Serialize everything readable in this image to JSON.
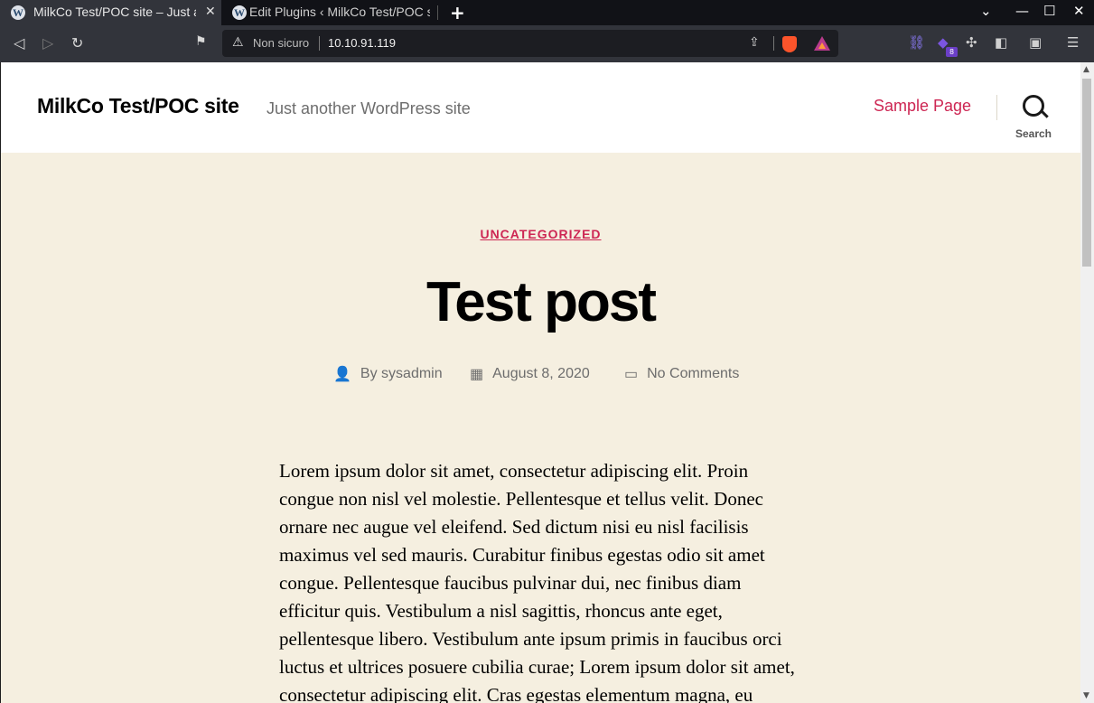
{
  "browser": {
    "tabs": [
      {
        "title": "MilkCo Test/POC site – Just another WordPress site",
        "favicon": "W",
        "close": "✕"
      },
      {
        "title": "Edit Plugins ‹ MilkCo Test/POC site — WordPress",
        "favicon": "W"
      }
    ],
    "new_tab": "+",
    "window_controls": {
      "minimize": "—",
      "maximize": "☐",
      "close": "✕"
    },
    "nav": {
      "back": "◁",
      "forward": "▷",
      "reload": "↻",
      "bookmark": "🔖"
    },
    "address": {
      "security_label": "Non sicuro",
      "url": "10.10.91.119",
      "share": "⇪"
    },
    "extensions": {
      "badge_count": "8"
    }
  },
  "site": {
    "title": "MilkCo Test/POC site",
    "description": "Just another WordPress site",
    "nav": {
      "sample_page": "Sample Page"
    },
    "search_label": "Search"
  },
  "post": {
    "category": "UNCATEGORIZED",
    "title": "Test post",
    "author": "By sysadmin",
    "date": "August 8, 2020",
    "comments": "No Comments",
    "body": "Lorem ipsum dolor sit amet, consectetur adipiscing elit. Proin congue non nisl vel molestie. Pellentesque et tellus velit. Donec ornare nec augue vel eleifend. Sed dictum nisi eu nisl facilisis maximus vel sed mauris. Curabitur finibus egestas odio sit amet congue. Pellentesque faucibus pulvinar dui, nec finibus diam efficitur quis. Vestibulum a nisl sagittis, rhoncus ante eget, pellentesque libero. Vestibulum ante ipsum primis in faucibus orci luctus et ultrices posuere cubilia curae; Lorem ipsum dolor sit amet, consectetur adipiscing elit. Cras egestas elementum magna, eu"
  },
  "colors": {
    "accent": "#cd2653",
    "background": "#f5efe0",
    "header": "#ffffff"
  }
}
